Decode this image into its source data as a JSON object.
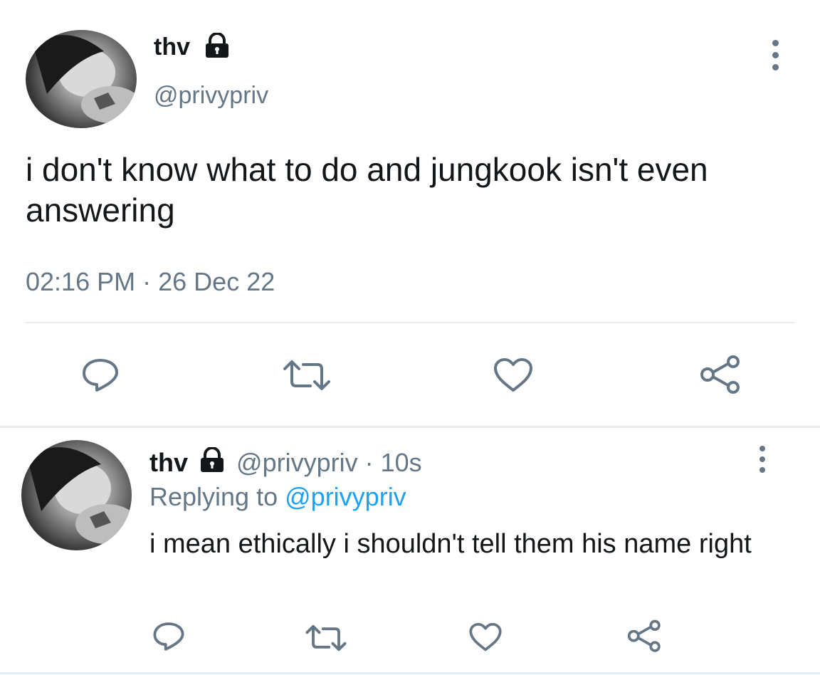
{
  "main_tweet": {
    "display_name": "thv",
    "handle": "@privypriv",
    "text": "i don't know what to do and jungkook isn't even answering",
    "time": "02:16 PM",
    "separator": "·",
    "date": "26 Dec 22"
  },
  "reply_tweet": {
    "display_name": "thv",
    "handle": "@privypriv",
    "separator": "·",
    "age": "10s",
    "replying_prefix": "Replying to",
    "replying_handle": "@privypriv",
    "text": "i mean ethically i shouldn't tell them his name right"
  },
  "icons": {
    "lock": "lock-icon",
    "more": "more-vertical-icon",
    "reply": "reply-icon",
    "retweet": "retweet-icon",
    "like": "heart-icon",
    "share": "share-icon"
  },
  "colors": {
    "text_primary": "#14171a",
    "text_secondary": "#657786",
    "link": "#1da1f2",
    "divider": "#e6ecf0"
  }
}
